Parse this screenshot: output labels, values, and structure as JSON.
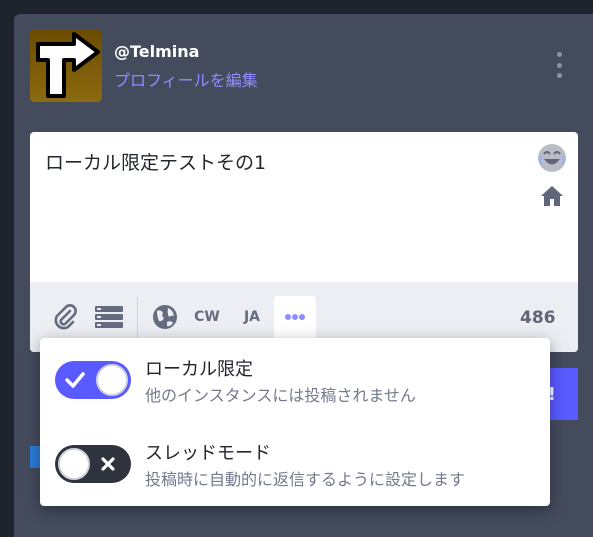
{
  "header": {
    "username": "@Telmina",
    "edit_profile": "プロフィールを編集"
  },
  "compose": {
    "text": "ローカル限定テストその1",
    "visibility_label": "CW",
    "language_label": "JA",
    "char_count": "486"
  },
  "toot_button": {
    "label": "!"
  },
  "dropdown": {
    "options": [
      {
        "title": "ローカル限定",
        "description": "他のインスタンスには投稿されません",
        "enabled": true
      },
      {
        "title": "スレッドモード",
        "description": "投稿時に自動的に返信するように設定します",
        "enabled": false
      }
    ]
  },
  "colors": {
    "accent": "#595aff",
    "toggle_on": "#595aff",
    "toggle_off": "#2f333e",
    "link": "#8c8dff"
  }
}
